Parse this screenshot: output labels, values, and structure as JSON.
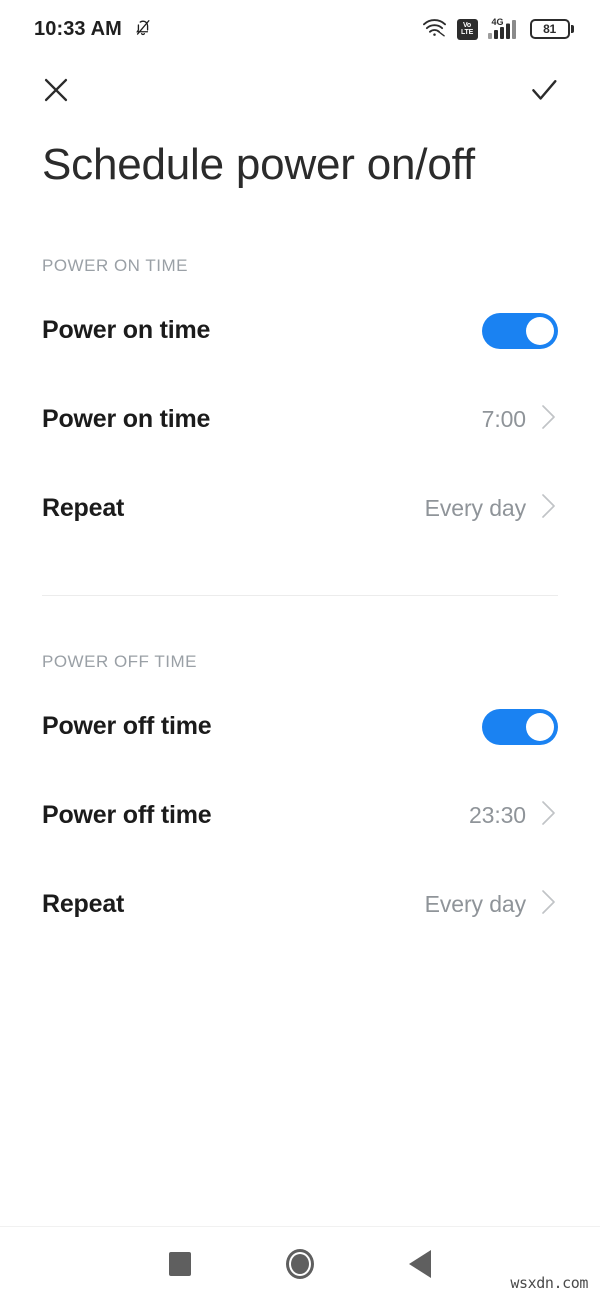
{
  "status_bar": {
    "time": "10:33 AM",
    "silent_icon": "bell-muted-icon",
    "wifi_icon": "wifi-icon",
    "volte_line1": "Vo",
    "volte_line2": "LTE",
    "network_type": "4G",
    "battery_level": "81"
  },
  "action_bar": {
    "close_label": "close-icon",
    "confirm_label": "checkmark-icon"
  },
  "title": "Schedule power on/off",
  "colors": {
    "toggle_on": "#1a82f2",
    "section_header": "#9aa0a6",
    "value_text": "#8f9499"
  },
  "sections": [
    {
      "header": "POWER ON TIME",
      "rows": [
        {
          "label": "Power on time",
          "type": "toggle",
          "state": "on"
        },
        {
          "label": "Power on time",
          "type": "value",
          "value": "7:00"
        },
        {
          "label": "Repeat",
          "type": "value",
          "value": "Every day"
        }
      ]
    },
    {
      "header": "POWER OFF TIME",
      "rows": [
        {
          "label": "Power off time",
          "type": "toggle",
          "state": "on"
        },
        {
          "label": "Power off time",
          "type": "value",
          "value": "23:30"
        },
        {
          "label": "Repeat",
          "type": "value",
          "value": "Every day"
        }
      ]
    }
  ],
  "nav_bar": {
    "recents_label": "recents-square-icon",
    "home_label": "home-circle-icon",
    "back_label": "back-triangle-icon"
  },
  "watermark": "wsxdn.com"
}
